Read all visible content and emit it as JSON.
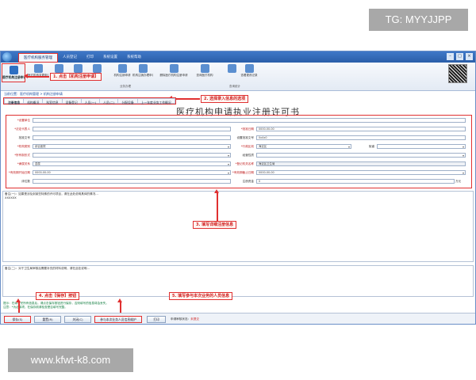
{
  "overlay": {
    "tg_text": "TG: MYYJJPP",
    "watermark": "www.kfwt-k8.com"
  },
  "window": {
    "title": "",
    "menu_tabs": [
      "医疗机构服务管理",
      "人员登记",
      "打印",
      "系统设置",
      "系统帮助"
    ],
    "controls": [
      "–",
      "□",
      "×"
    ]
  },
  "ribbon": {
    "first_button": "医疗机构注册申请",
    "items": [
      "医疗机构变更申请",
      "",
      "",
      "",
      "",
      "",
      "",
      "机构注销申请",
      "机构注销办理申请",
      "删除医疗机构注册申请",
      "查询医疗机构",
      "",
      "",
      "查看更改记录"
    ],
    "group_labels": [
      "业务办理",
      "查询统计"
    ]
  },
  "callouts": {
    "c1": "1. 点击【机构注册申请】",
    "c2": "2. 选择录入信息的选项",
    "c3": "3. 填写详细注册信息",
    "c4": "4. 点击【保存】按钮",
    "c5": "5. 填写参与本次业务的人员信息"
  },
  "location": "当前位置：医疗机构管理 > 机构注册申请",
  "subtabs": [
    "注册信息",
    "机构概况",
    "科室信息",
    "设备登记",
    "人员(一)",
    "人员(二)",
    "分配设备",
    "上一年度业务工作概况"
  ],
  "form_title": "医疗机构申请执业注册许可书",
  "form": {
    "rows": [
      {
        "l1": "*设置单位",
        "v1": "",
        "l2": "",
        "v2": ""
      },
      {
        "l1": "*法定代表人",
        "v1": "",
        "l2": "*批准日期",
        "v2": "0000-00-00"
      },
      {
        "l1": "批准文号",
        "v1": "",
        "l2": "设置批准文号",
        "v2": "0x4x0"
      },
      {
        "l1": "*机构类别",
        "v1": "综合医院",
        "l2": "*行政区划",
        "v2": "海淀区",
        "l3": "街道",
        "v3": ""
      },
      {
        "l1": "*所有制形式",
        "v1": "",
        "l2": "经营性质",
        "v2": ""
      },
      {
        "l1": "*隶属关系",
        "v1": "县属",
        "l2": "*登记机关名称",
        "v2": "海淀区卫生局"
      },
      {
        "l1": "*有效期开始日期",
        "v1": "0000-00-00",
        "l2": "*有效期截止日期",
        "v2": "0000-00-00"
      },
      {
        "l1": "床位数",
        "v1": "",
        "l2": "注册资金",
        "v2": "0",
        "unit": "万元"
      }
    ]
  },
  "area1": {
    "label": "备注(一)：如果是涉及到某些特殊的许可项目，请在此处说明具体的情况…",
    "value": "XXXXXX"
  },
  "area2": {
    "label": "备注(二)：对于卫生局审核后需要补充的材料说明，请在此处说明…"
  },
  "notices": {
    "n1": "提示：在填写完所有信息后，请点击保存按钮进行保存，否则填写的信息将会丢失。",
    "n2": "注意：*为必填项，在保存前请检查是否填写完整。"
  },
  "bottom": {
    "save": "保存(S)",
    "reset": "重置(R)",
    "close": "关闭(C)",
    "personnel": "参与本次业务人员信息维护",
    "print": "打印",
    "status_label": "申请审核状态：",
    "status_value": "未提交"
  }
}
